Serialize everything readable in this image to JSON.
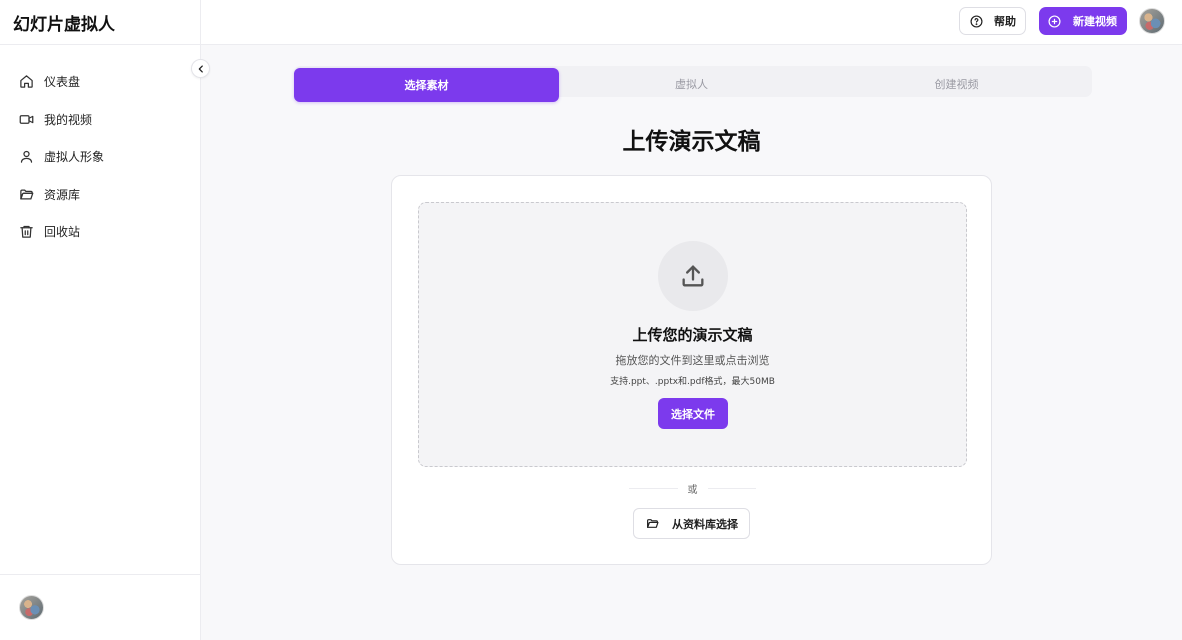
{
  "app": {
    "title": "幻灯片虚拟人"
  },
  "sidebar": {
    "items": [
      {
        "label": "仪表盘",
        "icon": "home-icon"
      },
      {
        "label": "我的视频",
        "icon": "video-icon"
      },
      {
        "label": "虚拟人形象",
        "icon": "user-icon"
      },
      {
        "label": "资源库",
        "icon": "folder-icon"
      },
      {
        "label": "回收站",
        "icon": "trash-icon"
      }
    ],
    "collapse_icon": "chevron-left-icon"
  },
  "header": {
    "help_label": "帮助",
    "new_video_label": "新建视频"
  },
  "steps": [
    {
      "label": "选择素材",
      "active": true
    },
    {
      "label": "虚拟人",
      "active": false
    },
    {
      "label": "创建视频",
      "active": false
    }
  ],
  "main": {
    "title": "上传演示文稿",
    "upload": {
      "title": "上传您的演示文稿",
      "subtitle": "拖放您的文件到这里或点击浏览",
      "formats": "支持.ppt、.pptx和.pdf格式，最大50MB",
      "choose_label": "选择文件"
    },
    "or_label": "或",
    "library_label": "从资料库选择"
  },
  "colors": {
    "accent": "#7c3aed",
    "background": "#f8f8fa",
    "dropzone": "#f4f4f6"
  }
}
